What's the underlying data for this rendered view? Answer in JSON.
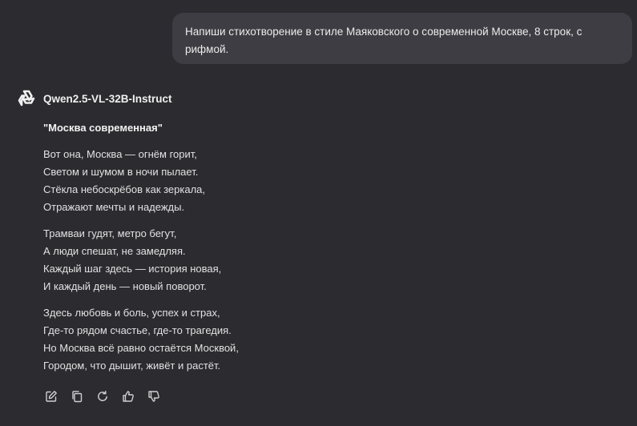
{
  "user_message": {
    "text": "Напиши стихотворение в стиле Маяковского о современной Москве, 8 строк, с рифмой."
  },
  "assistant": {
    "model_name": "Qwen2.5-VL-32B-Instruct",
    "poem_title": "\"Москва современная\"",
    "stanzas": [
      {
        "lines": [
          "Вот она, Москва — огнём горит,",
          "Светом и шумом в ночи пылает.",
          "Стёкла небоскрёбов как зеркала,",
          "Отражают мечты и надежды."
        ]
      },
      {
        "lines": [
          "Трамваи гудят, метро бегут,",
          "А люди спешат, не замедляя.",
          "Каждый шаг здесь — история новая,",
          "И каждый день — новый поворот."
        ]
      },
      {
        "lines": [
          "Здесь любовь и боль, успех и страх,",
          "Где-то рядом счастье, где-то трагедия.",
          "Но Москва всё равно остаётся Москвой,",
          "Городом, что дышит, живёт и растёт."
        ]
      }
    ]
  },
  "actions": {
    "icons": [
      "edit-icon",
      "copy-icon",
      "regenerate-icon",
      "thumbs-up-icon",
      "thumbs-down-icon"
    ]
  }
}
